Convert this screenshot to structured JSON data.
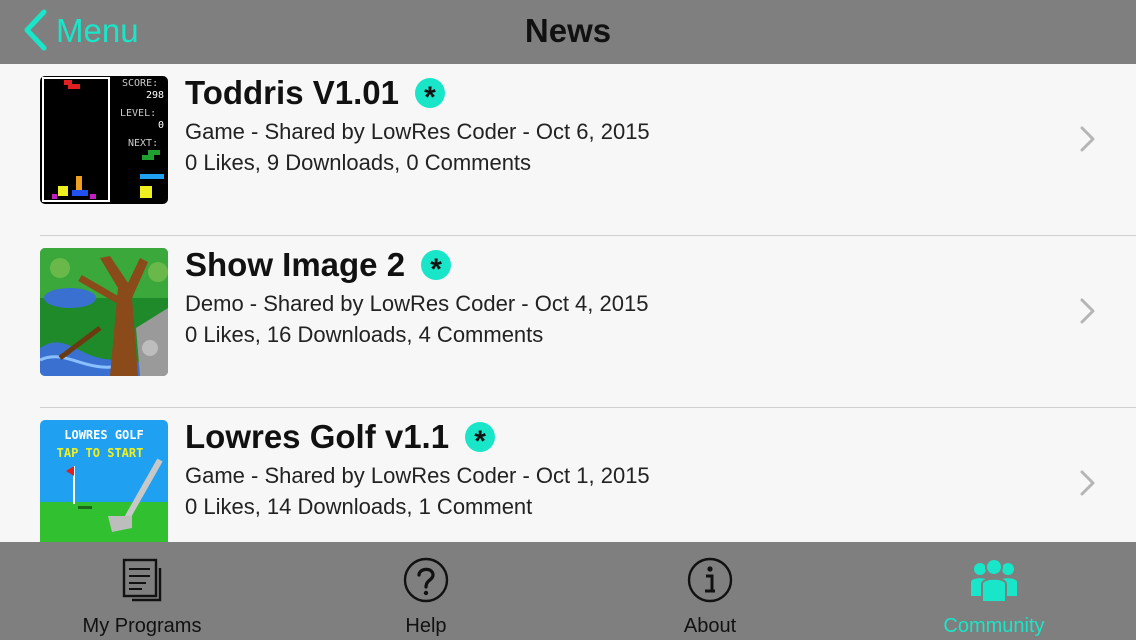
{
  "navbar": {
    "back_label": "Menu",
    "title": "News"
  },
  "items": [
    {
      "title": "Toddris V1.01",
      "subtitle": "Game - Shared by LowRes Coder - Oct 6, 2015",
      "stats": "0 Likes, 9 Downloads, 0 Comments",
      "badge": "*",
      "thumb_text": {
        "score_label": "SCORE:",
        "score": "298",
        "level_label": "LEVEL:",
        "level": "0",
        "next_label": "NEXT:"
      }
    },
    {
      "title": "Show Image 2",
      "subtitle": "Demo - Shared by LowRes Coder - Oct 4, 2015",
      "stats": "0 Likes, 16 Downloads, 4 Comments",
      "badge": "*"
    },
    {
      "title": "Lowres Golf v1.1",
      "subtitle": "Game - Shared by LowRes Coder - Oct 1, 2015",
      "stats": "0 Likes, 14 Downloads, 1 Comment",
      "badge": "*",
      "thumb_text": {
        "line1": "LOWRES GOLF",
        "line2": "TAP TO START"
      }
    }
  ],
  "tabs": [
    {
      "label": "My Programs",
      "icon": "document-icon",
      "active": false
    },
    {
      "label": "Help",
      "icon": "question-icon",
      "active": false
    },
    {
      "label": "About",
      "icon": "info-icon",
      "active": false
    },
    {
      "label": "Community",
      "icon": "people-icon",
      "active": true
    }
  ],
  "colors": {
    "accent": "#19e6c8",
    "bar": "#7f7f7f",
    "background": "#f7f7f7"
  }
}
